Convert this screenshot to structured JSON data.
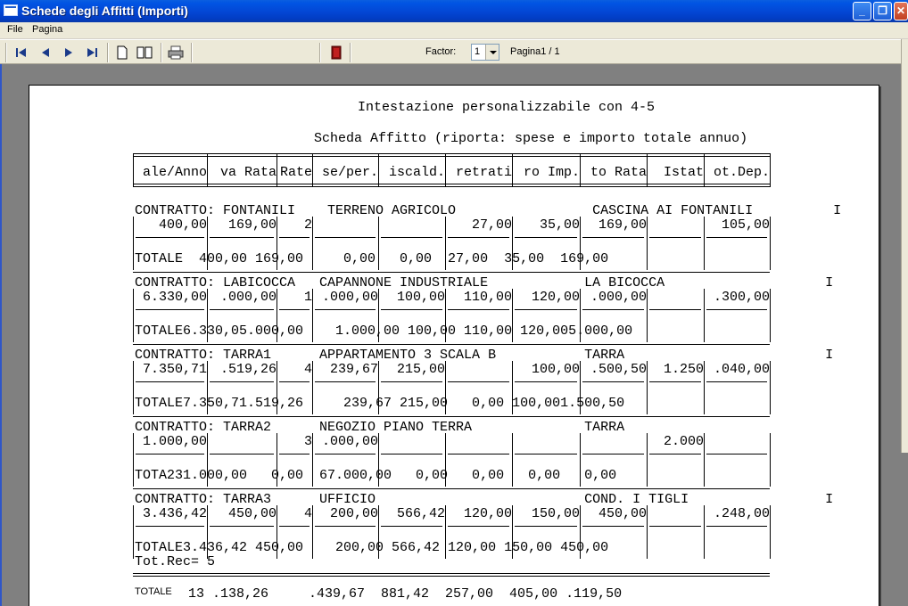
{
  "window": {
    "title": "Schede degli Affitti (Importi)"
  },
  "menu": [
    "File",
    "Pagina"
  ],
  "toolbar": {
    "factor_label": "Factor:",
    "factor_value": "1",
    "page_label": "Pagina1 / 1",
    "icons": [
      "first-page-icon",
      "prev-page-icon",
      "next-page-icon",
      "last-page-icon",
      "single-page-icon",
      "two-pages-icon",
      "print-icon",
      "exit-icon"
    ]
  },
  "report": {
    "header_line": "Intestazione personalizzabile con 4-5",
    "subtitle": "Scheda Affitto (riporta: spese e importo totale annuo)",
    "columns": [
      "ale/Anno",
      "va Rata",
      "Rate",
      "se/per.",
      "iscald.",
      "retrati",
      "ro Imp.",
      "to Rata",
      "Istat",
      "ot.Dep."
    ],
    "contracts": [
      {
        "header": "CONTRATTO: FONTANILI    TERRENO AGRICOLO                 CASCINA AI FONTANILI          I",
        "values": [
          "400,00",
          "169,00",
          "2",
          "",
          "",
          "27,00",
          "35,00",
          "169,00",
          "",
          "105,00"
        ],
        "totale": "TOTALE  400,00 169,00     0,00   0,00  27,00  35,00  169,00",
        "extra": ""
      },
      {
        "header": "CONTRATTO: LABICOCCA   CAPANNONE INDUSTRIALE            LA BICOCCA                    I",
        "values": [
          "6.330,00",
          ".000,00",
          "1",
          ".000,00",
          "100,00",
          "110,00",
          "120,00",
          ".000,00",
          "",
          ".300,00"
        ],
        "totale": "TOTALE6.330,05.000,00    1.000,00 100,00 110,00 120,005.000,00",
        "extra": ""
      },
      {
        "header": "CONTRATTO: TARRA1      APPARTAMENTO 3 SCALA B           TARRA                         I",
        "values": [
          "7.350,71",
          ".519,26",
          "4",
          "239,67",
          "215,00",
          "",
          "100,00",
          ".500,50",
          "1.250",
          ".040,00"
        ],
        "totale": "TOTALE7.350,71.519,26     239,67 215,00   0,00 100,001.500,50",
        "extra": ""
      },
      {
        "header": "CONTRATTO: TARRA2      NEGOZIO PIANO TERRA              TARRA",
        "values": [
          "1.000,00",
          "",
          "3",
          ".000,00",
          "",
          "",
          "",
          "",
          "2.000",
          ""
        ],
        "totale": "TOTA231.000,00   0,00  67.000,00   0,00   0,00   0,00   0,00",
        "extra": ""
      },
      {
        "header": "CONTRATTO: TARRA3      UFFICIO                          COND. I TIGLI                 I",
        "values": [
          "3.436,42",
          "450,00",
          "4",
          "200,00",
          "566,42",
          "120,00",
          "150,00",
          "450,00",
          "",
          ".248,00"
        ],
        "totale": "TOTALE3.436,42 450,00    200,00 566,42 120,00 150,00 450,00",
        "extra": "Tot.Rec= 5"
      }
    ],
    "grand_total_label": "TOTALE",
    "grand_total_values": "13 .138,26     .439,67  881,42  257,00  405,00 .119,50"
  }
}
